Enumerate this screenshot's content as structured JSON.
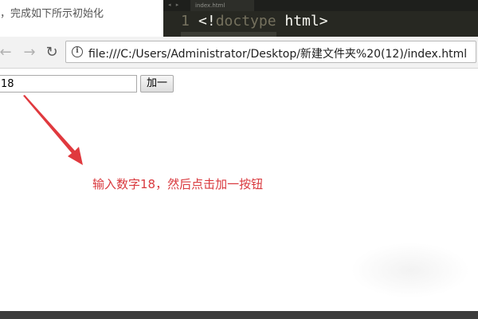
{
  "article": {
    "text": "，完成如下所示初始化"
  },
  "editor": {
    "tab_label": "index.html",
    "nav_label": "◂ ▸",
    "line_number": "1",
    "code_open": "<!",
    "code_doctype": "doctype",
    "code_html": " html>"
  },
  "browser": {
    "back_icon": "←",
    "forward_icon": "→",
    "reload_icon": "↻",
    "info_icon": "i",
    "url": "file:///C:/Users/Administrator/Desktop/新建文件夹%20(12)/index.html"
  },
  "page": {
    "input_value": "18",
    "add_button_label": "加一",
    "annotation": "输入数字18，然后点击加一按钮",
    "annotation_color": "#d9393e"
  }
}
